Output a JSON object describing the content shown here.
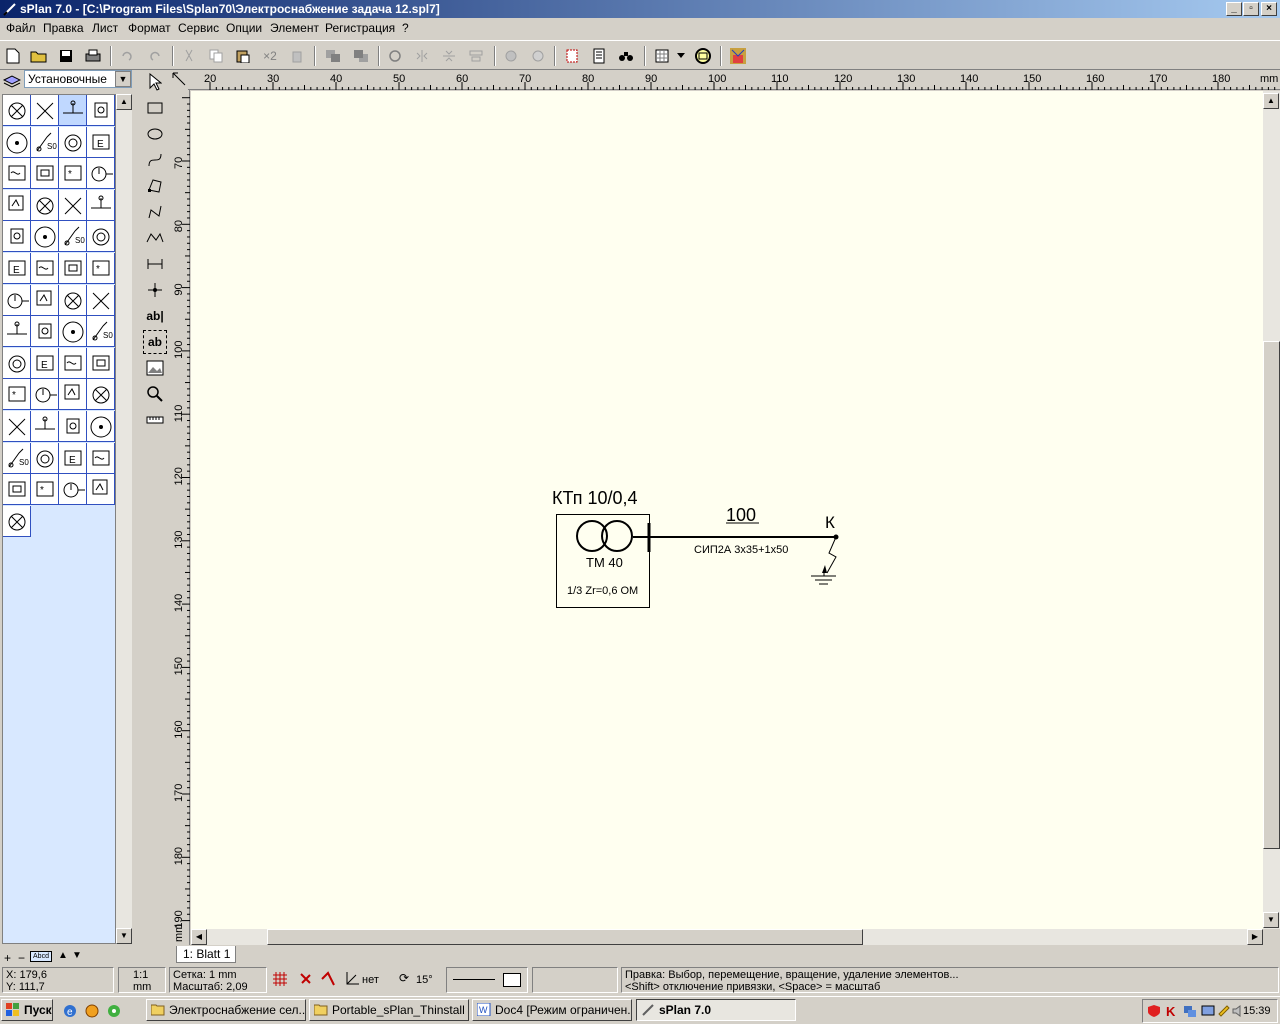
{
  "window": {
    "title": "sPlan 7.0 - [C:\\Program Files\\Splan70\\Электроснабжение задача 12.spl7]",
    "buttons": [
      "_",
      "▫",
      "×"
    ]
  },
  "menu": [
    "Файл",
    "Правка",
    "Лист",
    "Формат",
    "Сервис",
    "Опции",
    "Элемент",
    "Регистрация",
    "?"
  ],
  "toolbar": {
    "x2_label": "×2"
  },
  "library": {
    "selected": "Установочные",
    "bottom_label": "Abcd"
  },
  "draw_tools": {
    "text_tool": "ab|",
    "text_frame_tool": "ab"
  },
  "ruler": {
    "top": [
      "20",
      "30",
      "40",
      "50",
      "60",
      "70",
      "80",
      "90",
      "100",
      "110",
      "120",
      "130",
      "140",
      "150",
      "160",
      "170",
      "180"
    ],
    "top_unit": "mm",
    "left": [
      "70",
      "80",
      "90",
      "100",
      "110",
      "120",
      "130",
      "140",
      "150",
      "160",
      "170",
      "180",
      "190"
    ],
    "left_unit": "mm"
  },
  "schematic": {
    "substation_label": "КТп 10/0,4",
    "transformer_label": "ТМ 40",
    "impedance_label": "1/3 Zr=0,6 OM",
    "line_length": "100",
    "cable_label": "СИП2А 3x35+1x50",
    "fault_point": "К"
  },
  "sheet_tab": "1: Blatt 1",
  "status": {
    "x": "X: 179,6",
    "y": "Y: 111,7",
    "scale_top": "1:1",
    "scale_unit": "mm",
    "grid": "Сетка: 1 mm",
    "zoom": "Масштаб:  2,09",
    "snap_label": "нет",
    "angle": "15°",
    "hint1": "Правка: Выбор, перемещение, вращение, удаление элементов...",
    "hint2": "<Shift> отключение привязки, <Space> = масштаб"
  },
  "taskbar": {
    "start": "Пуск",
    "tasks": [
      "Электроснабжение сел...",
      "Portable_sPlan_Thinstall",
      "Doc4 [Режим ограничен...",
      "sPlan 7.0"
    ],
    "clock": "15:39"
  },
  "colors": {
    "titlebar": "#0a246a",
    "canvas": "#fffff0",
    "library_grid": "#3050c0"
  }
}
